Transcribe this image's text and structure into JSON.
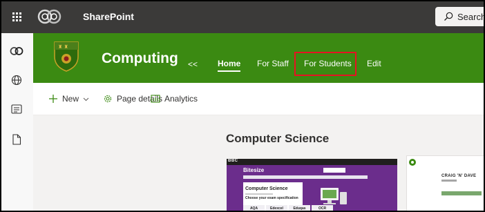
{
  "suite_bar": {
    "app_name": "SharePoint",
    "search_placeholder": "Search"
  },
  "site": {
    "title": "Computing",
    "collapse_label": "<<",
    "nav": [
      {
        "label": "Home",
        "selected": true
      },
      {
        "label": "For Staff"
      },
      {
        "label": "For Students",
        "highlighted": true
      },
      {
        "label": "Edit"
      }
    ]
  },
  "command_bar": {
    "new_label": "New",
    "page_details_label": "Page details",
    "analytics_label": "Analytics"
  },
  "content": {
    "section_title": "Computer Science",
    "cards": [
      {
        "brand": "Bitesize",
        "header_logo": "BBC",
        "panel_title": "Computer Science",
        "panel_subtitle": "Choose your exam specification",
        "tabs": [
          "AQA",
          "Edexcel",
          "Eduqas",
          "OCR"
        ]
      },
      {
        "title": "CRAIG 'N' DAVE"
      }
    ]
  },
  "colors": {
    "suite_bar": "#3b3a39",
    "site_header": "#3b8a12",
    "highlight_box": "#e81123",
    "bitesize_purple": "#6b2d8c"
  }
}
